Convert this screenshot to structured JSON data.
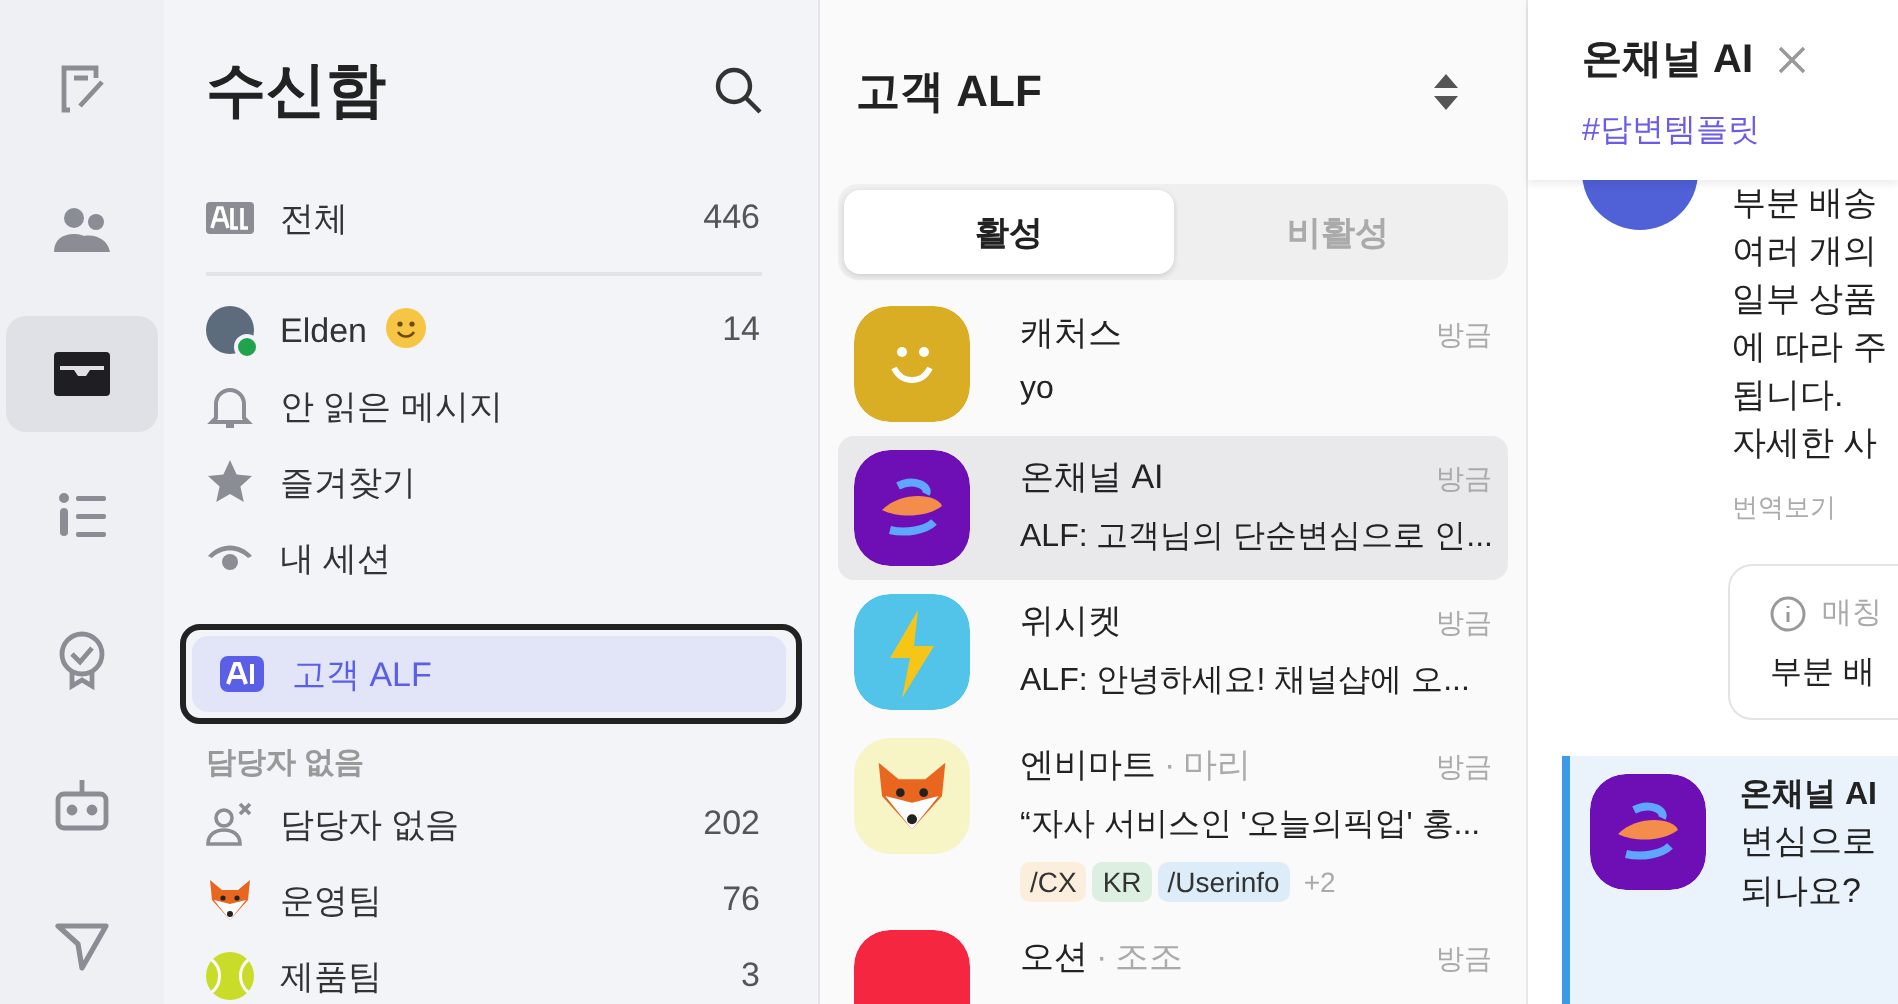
{
  "rail": [
    {
      "kind": "compose",
      "selected": false
    },
    {
      "kind": "contacts",
      "selected": false
    },
    {
      "kind": "inbox",
      "selected": true
    },
    {
      "kind": "list",
      "selected": false
    },
    {
      "kind": "badge",
      "selected": false
    },
    {
      "kind": "bot",
      "selected": false
    },
    {
      "kind": "send",
      "selected": false
    }
  ],
  "inbox": {
    "title": "수신함",
    "items": [
      {
        "kind": "all",
        "label": "전체",
        "count": "446",
        "selected": false
      },
      {
        "kind": "user",
        "label": "Elden",
        "count": "14",
        "online": true,
        "selected": false
      },
      {
        "kind": "bell",
        "label": "안 읽은 메시지",
        "selected": false
      },
      {
        "kind": "star",
        "label": "즐겨찾기",
        "selected": false
      },
      {
        "kind": "eye",
        "label": "내 세션",
        "selected": false
      },
      {
        "kind": "ai",
        "label": "고객 ALF",
        "selected": true
      }
    ],
    "section": "담당자 없음",
    "teams": [
      {
        "kind": "unassigned",
        "label": "담당자 없음",
        "count": "202",
        "selected": false
      },
      {
        "kind": "fox",
        "label": "운영팀",
        "count": "76",
        "selected": false
      },
      {
        "kind": "ball",
        "label": "제품팀",
        "count": "3",
        "selected": false
      }
    ]
  },
  "list": {
    "title": "고객 ALF",
    "tabs": [
      {
        "label": "활성",
        "selected": true
      },
      {
        "label": "비활성",
        "selected": false
      }
    ],
    "conversations": [
      {
        "kind": "smile",
        "name": "캐처스",
        "time": "방금",
        "preview": "yo",
        "selected": false
      },
      {
        "kind": "swirl",
        "name": "온채널 AI",
        "time": "방금",
        "preview": "ALF: 고객님의 단순변심으로 인...",
        "selected": true
      },
      {
        "kind": "bolt",
        "name": "위시켓",
        "time": "방금",
        "preview": "ALF: 안녕하세요! 채널샵에 오...",
        "selected": false
      },
      {
        "kind": "fox",
        "name": "엔비마트",
        "separator": "·",
        "assignee": "마리",
        "time": "방금",
        "preview": "“자사 서비스인 '오늘의픽업' 홍...",
        "selected": false,
        "tags": [
          {
            "label": "/CX",
            "color": "#fbeedd"
          },
          {
            "label": "KR",
            "color": "#dcefe0"
          },
          {
            "label": "/Userinfo",
            "color": "#dcecf8"
          }
        ],
        "more": "+2"
      },
      {
        "kind": "red",
        "name": "오션",
        "separator": "·",
        "assignee": "조조",
        "time": "방금",
        "selected": false
      }
    ]
  },
  "detail": {
    "title": "온채널 AI",
    "tag": "#답변템플릿",
    "message_lines": [
      "부분 배송",
      "여러 개의",
      "일부 상품",
      "에 따라 주",
      "됩니다.",
      "자세한 사"
    ],
    "translate": "번역보기",
    "card": {
      "label": "매칭",
      "text": "부분 배"
    },
    "reply": {
      "author": "온채널 AI",
      "lines": [
        "변심으로",
        "되나요?"
      ]
    }
  }
}
